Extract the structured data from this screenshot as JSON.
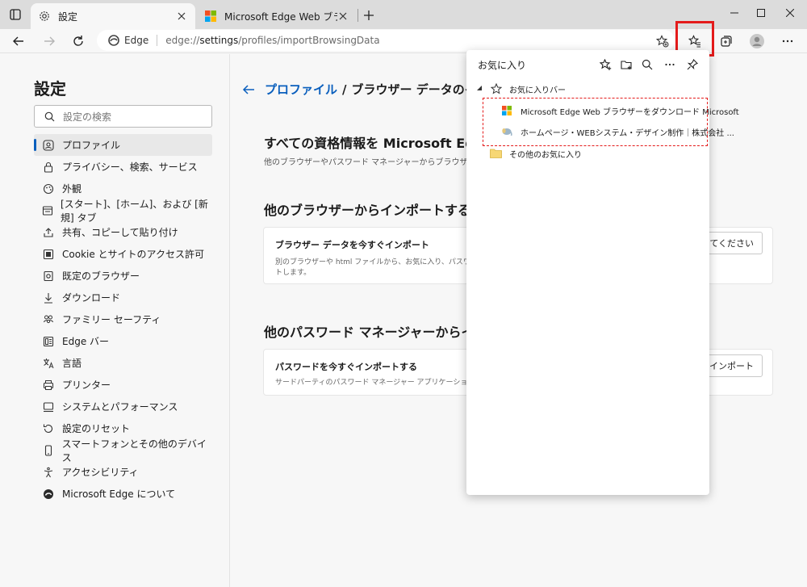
{
  "tabs": [
    {
      "title": "設定",
      "icon": "gear-icon"
    },
    {
      "title": "Microsoft Edge Web ブラウザーをダ",
      "icon": "microsoft-logo-icon"
    }
  ],
  "address": {
    "site_label": "Edge",
    "url_prefix": "edge://",
    "url_strong": "settings",
    "url_rest": "/profiles/importBrowsingData"
  },
  "sidebar": {
    "title": "設定",
    "search_placeholder": "設定の検索",
    "items": [
      {
        "label": "プロファイル",
        "icon": "profile-icon",
        "active": true
      },
      {
        "label": "プライバシー、検索、サービス",
        "icon": "lock-icon"
      },
      {
        "label": "外観",
        "icon": "appearance-icon"
      },
      {
        "label": "[スタート]、[ホーム]、および [新規] タブ",
        "icon": "start-tab-icon"
      },
      {
        "label": "共有、コピーして貼り付け",
        "icon": "share-icon"
      },
      {
        "label": "Cookie とサイトのアクセス許可",
        "icon": "cookie-icon"
      },
      {
        "label": "既定のブラウザー",
        "icon": "default-browser-icon"
      },
      {
        "label": "ダウンロード",
        "icon": "download-icon"
      },
      {
        "label": "ファミリー セーフティ",
        "icon": "family-icon"
      },
      {
        "label": "Edge バー",
        "icon": "edge-bar-icon"
      },
      {
        "label": "言語",
        "icon": "language-icon"
      },
      {
        "label": "プリンター",
        "icon": "printer-icon"
      },
      {
        "label": "システムとパフォーマンス",
        "icon": "system-icon"
      },
      {
        "label": "設定のリセット",
        "icon": "reset-icon"
      },
      {
        "label": "スマートフォンとその他のデバイス",
        "icon": "phone-icon"
      },
      {
        "label": "アクセシビリティ",
        "icon": "accessibility-icon"
      },
      {
        "label": "Microsoft Edge について",
        "icon": "edge-logo-icon"
      }
    ]
  },
  "main": {
    "breadcrumb_link": "プロファイル",
    "breadcrumb_sep": "/",
    "breadcrumb_current": "ブラウザー データのインポ",
    "section1_title": "すべての資格情報を Microsoft Edge",
    "section1_sub": "他のブラウザーやパスワード マネージャーからブラウザー デー",
    "section2_title": "他のブラウザーからインポートする",
    "card1_title": "ブラウザー データを今すぐインポート",
    "card1_desc_line1": "別のブラウザーや html ファイルから、お気に入り、パスワード、履",
    "card1_desc_line2": "トします。",
    "card1_button": "択してください",
    "section3_title": "他のパスワード マネージャーからインポー",
    "card2_title": "パスワードを今すぐインポートする",
    "card2_desc": "サードパーティのパスワード マネージャー アプリケーションからパスワ",
    "card2_button": "ドのインポート"
  },
  "favorites": {
    "title": "お気に入り",
    "bar_label": "お気に入りバー",
    "items": [
      {
        "label": "Microsoft Edge Web ブラウザーをダウンロード Microsoft",
        "icon": "microsoft-logo-icon"
      },
      {
        "label": "ホームページ・WEBシステム・デザイン制作｜株式会社 ...",
        "icon": "elephant-icon"
      }
    ],
    "other_folder": "その他のお気に入り"
  },
  "colors": {
    "accent": "#0a5fbd",
    "highlight": "#e41b1b",
    "tabstrip": "#dcdcdc"
  }
}
